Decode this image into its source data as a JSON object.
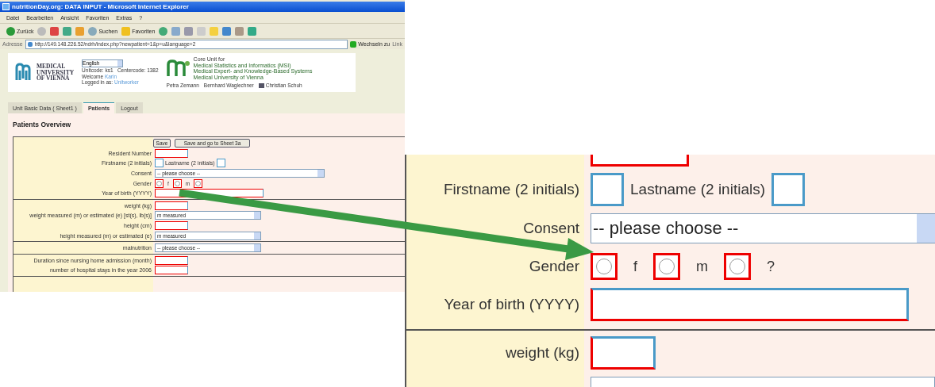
{
  "browser": {
    "title": "nutritionDay.org: DATA INPUT - Microsoft Internet Explorer",
    "menu": [
      "Datei",
      "Bearbeiten",
      "Ansicht",
      "Favoriten",
      "Extras",
      "?"
    ],
    "toolbar": {
      "back": "Zurück",
      "search": "Suchen",
      "favorites": "Favoriten"
    },
    "address": {
      "label": "Adresse",
      "url": "http://149.148.226.52/ndrh/index.php?newpatient=1&p=u&language=2",
      "go": "Wechseln zu",
      "links": "Link"
    }
  },
  "header": {
    "logo": [
      "MEDICAL",
      "UNIVERSITY",
      "OF VIENNA"
    ],
    "language": "English",
    "unitcode": "Unitcode: ks1",
    "centercode": "Centercode: 1382",
    "welcome": "Welcome",
    "user": "Karin",
    "logged_in": "Logged in as:",
    "role": "Unitworker",
    "core_unit": [
      "Core Unit for",
      "Medical Statistics and Informatics (MSI)",
      "Medical Expert- and Knowledge-Based Systems",
      "Medical University of Vienna"
    ],
    "people": [
      {
        "name": "Petra Zemann",
        "mail": false
      },
      {
        "name": "Bernhard Waglechner",
        "mail": false
      },
      {
        "name": "Christian Schuh",
        "mail": true
      }
    ]
  },
  "tabs": [
    {
      "label": "Unit Basic Data ( Sheet1 )",
      "selected": false
    },
    {
      "label": "Patients",
      "selected": true
    },
    {
      "label": "Logout",
      "selected": false
    }
  ],
  "heading": "Patients Overview",
  "buttons": [
    "Save",
    "Save and go to Sheet 3a"
  ],
  "sections": [
    [
      {
        "kind": "text",
        "label": "Resident Number",
        "required": true
      },
      {
        "kind": "initials",
        "label": "Firstname (2 initials)",
        "label2": "Lastname (2 initials)"
      },
      {
        "kind": "select",
        "label": "Consent",
        "value": "-- please choose --",
        "wide": true
      },
      {
        "kind": "radio",
        "label": "Gender",
        "options": [
          {
            "label": "f",
            "checked": false
          },
          {
            "label": "m",
            "checked": false
          },
          {
            "checked": false
          }
        ]
      },
      {
        "kind": "text",
        "label": "Year of birth (YYYY)",
        "required": true,
        "wide": true
      }
    ],
    [
      {
        "kind": "text",
        "label": "weight (kg)",
        "required": true
      },
      {
        "kind": "select",
        "label": "weight measured (m) or estimated (e) [st(s), lb(s)]",
        "value": "m measured"
      },
      {
        "kind": "text",
        "label": "height (cm)",
        "required": true
      },
      {
        "kind": "select",
        "label": "height measured (m) or estimated (e)",
        "value": "m measured"
      }
    ],
    [
      {
        "kind": "select",
        "label": "malnutrition",
        "value": "-- please choose --"
      }
    ],
    [
      {
        "kind": "text",
        "label": "Duration since nursing home admission (month)",
        "required": true
      },
      {
        "kind": "text",
        "label": "number of hospital stays in the year 2006",
        "required": true
      }
    ]
  ],
  "zoom": [
    {
      "kind": "initials",
      "label": "Firstname (2 initials)",
      "label2": "Lastname (2 initials)"
    },
    {
      "kind": "select",
      "label": "Consent",
      "value": "-- please choose --",
      "wide": true
    },
    {
      "kind": "radio",
      "label": "Gender",
      "options": [
        {
          "label": "f",
          "checked": false
        },
        {
          "label": "m",
          "checked": false
        },
        {
          "label": "?",
          "checked": false
        }
      ]
    },
    {
      "kind": "text",
      "label": "Year of birth (YYYY)",
      "required": true,
      "wide": true
    },
    {
      "kind": "divider"
    },
    {
      "kind": "text",
      "label": "weight (kg)",
      "required": true
    }
  ]
}
